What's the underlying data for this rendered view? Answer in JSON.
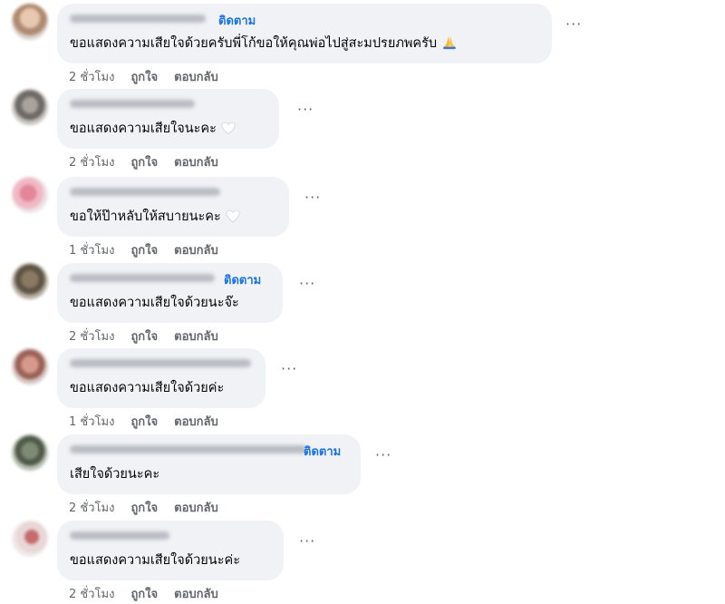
{
  "comments": [
    {
      "follow_label": "ติดตาม",
      "text": "ขอแสดงความเสียใจด้วยครับพี่โก้ขอให้คุณพ่อไปสู่สะมปรยภพครับ",
      "emoji": "pray-icon",
      "time": "2 ชั่วโมง",
      "like_label": "ถูกใจ",
      "reply_label": "ตอบกลับ"
    },
    {
      "follow_label": "",
      "text": "ขอแสดงความเสียใจนะคะ",
      "emoji": "heart-icon",
      "time": "2 ชั่วโมง",
      "like_label": "ถูกใจ",
      "reply_label": "ตอบกลับ"
    },
    {
      "follow_label": "",
      "text": "ขอให้ป๊าหลับให้สบายนะคะ",
      "emoji": "heart-icon",
      "time": "1 ชั่วโมง",
      "like_label": "ถูกใจ",
      "reply_label": "ตอบกลับ"
    },
    {
      "follow_label": "ติดตาม",
      "text": "ขอแสดงความเสียใจด้วยนะจ๊ะ",
      "emoji": "",
      "time": "2 ชั่วโมง",
      "like_label": "ถูกใจ",
      "reply_label": "ตอบกลับ"
    },
    {
      "follow_label": "",
      "text": "ขอแสดงความเสียใจด้วยค่ะ",
      "emoji": "",
      "time": "1 ชั่วโมง",
      "like_label": "ถูกใจ",
      "reply_label": "ตอบกลับ"
    },
    {
      "follow_label": "ติดตาม",
      "text": "เสียใจด้วยนะคะ",
      "emoji": "",
      "time": "2 ชั่วโมง",
      "like_label": "ถูกใจ",
      "reply_label": "ตอบกลับ"
    },
    {
      "follow_label": "",
      "text": "ขอแสดงความเสียใจด้วยนะค่ะ",
      "emoji": "",
      "time": "2 ชั่วโมง",
      "like_label": "ถูกใจ",
      "reply_label": "ตอบกลับ"
    }
  ],
  "more_label": "···",
  "colors": {
    "bubble": "#f0f2f5",
    "follow": "#1b74e4",
    "meta": "#65676b",
    "text": "#050505"
  }
}
